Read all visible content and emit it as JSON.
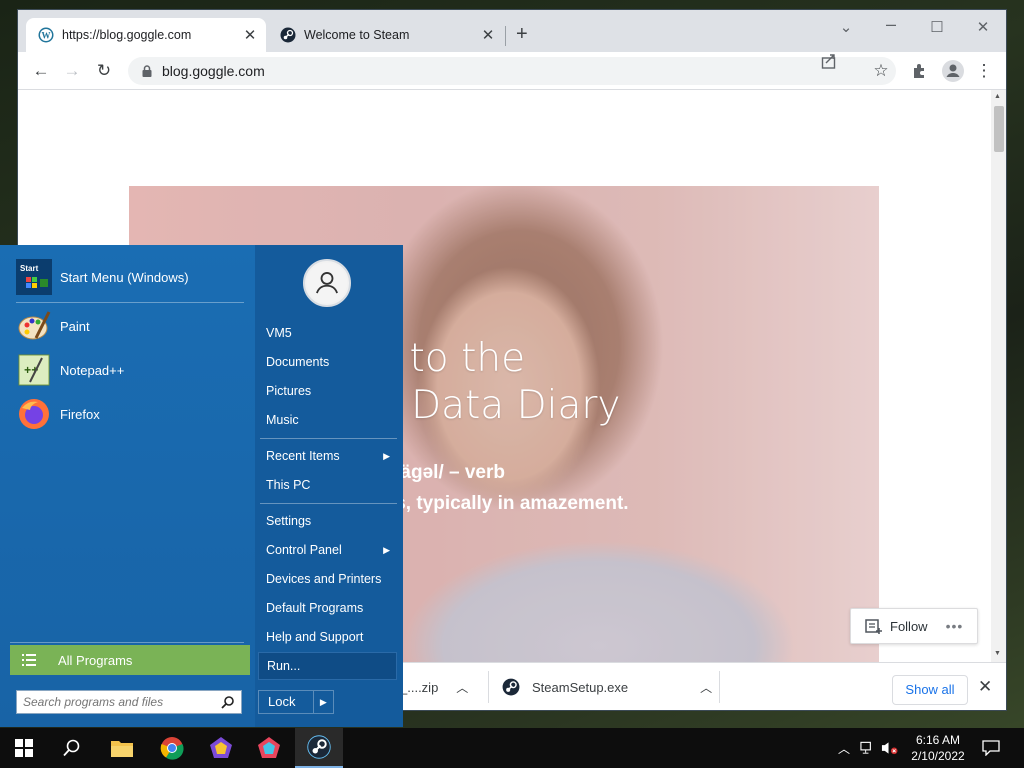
{
  "browser": {
    "tabs": [
      {
        "title": "https://blog.goggle.com",
        "favicon": "wordpress-icon",
        "active": true
      },
      {
        "title": "Welcome to Steam",
        "favicon": "steam-icon",
        "active": false
      }
    ],
    "address": "blog.goggle.com",
    "page": {
      "heading_line1": "lcome to the",
      "heading_line2": "e.com Data Diary",
      "definition_line1": "OGGLE: /ˈgägəl/ – verb",
      "definition_line2": "e open eyes, typically in amazement.",
      "follow_label": "Follow",
      "more_label": "•••"
    },
    "downloads": [
      {
        "name": "_....zip",
        "icon": "zip-file-icon"
      },
      {
        "name": "SteamSetup.exe",
        "icon": "steam-icon"
      }
    ],
    "show_all_label": "Show all"
  },
  "start_menu": {
    "pinned": [
      {
        "label": "Start Menu (Windows)",
        "icon": "start-menu-icon"
      },
      {
        "label": "Paint",
        "icon": "paint-icon"
      },
      {
        "label": "Notepad++",
        "icon": "notepadpp-icon"
      },
      {
        "label": "Firefox",
        "icon": "firefox-icon"
      }
    ],
    "all_programs": "All Programs",
    "search_placeholder": "Search programs and files",
    "right": {
      "user": "VM5",
      "documents": "Documents",
      "pictures": "Pictures",
      "music": "Music",
      "recent_items": "Recent Items",
      "this_pc": "This PC",
      "settings": "Settings",
      "control_panel": "Control Panel",
      "devices_printers": "Devices and Printers",
      "default_programs": "Default Programs",
      "help_support": "Help and Support",
      "run": "Run..."
    },
    "lock_label": "Lock"
  },
  "taskbar": {
    "time": "6:16 AM",
    "date": "2/10/2022"
  },
  "colors": {
    "start_menu_bg": "#1a6db3",
    "all_programs_bg": "#7ab356",
    "highlight": "#0f4c86",
    "link_blue": "#1a73e8"
  }
}
